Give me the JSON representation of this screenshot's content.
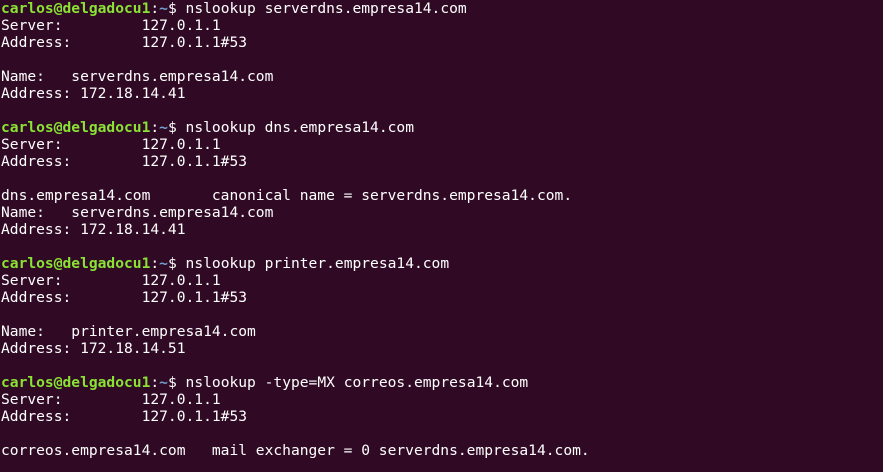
{
  "terminal": {
    "background": "#300a24",
    "foreground": "#ffffff",
    "prompt_user_color": "#8ae234",
    "prompt_path_color": "#729fcf",
    "prompt": {
      "user_host": "carlos@delgadocu1",
      "separator": ":",
      "path": "~",
      "symbol": "$ "
    },
    "blocks": [
      {
        "command": "nslookup serverdns.empresa14.com",
        "output": [
          "Server:         127.0.1.1",
          "Address:        127.0.1.1#53",
          "",
          "Name:   serverdns.empresa14.com",
          "Address: 172.18.14.41",
          ""
        ]
      },
      {
        "command": "nslookup dns.empresa14.com",
        "output": [
          "Server:         127.0.1.1",
          "Address:        127.0.1.1#53",
          "",
          "dns.empresa14.com       canonical name = serverdns.empresa14.com.",
          "Name:   serverdns.empresa14.com",
          "Address: 172.18.14.41",
          ""
        ]
      },
      {
        "command": "nslookup printer.empresa14.com",
        "output": [
          "Server:         127.0.1.1",
          "Address:        127.0.1.1#53",
          "",
          "Name:   printer.empresa14.com",
          "Address: 172.18.14.51",
          ""
        ]
      },
      {
        "command": "nslookup -type=MX correos.empresa14.com",
        "output": [
          "Server:         127.0.1.1",
          "Address:        127.0.1.1#53",
          "",
          "correos.empresa14.com   mail exchanger = 0 serverdns.empresa14.com."
        ]
      }
    ]
  }
}
